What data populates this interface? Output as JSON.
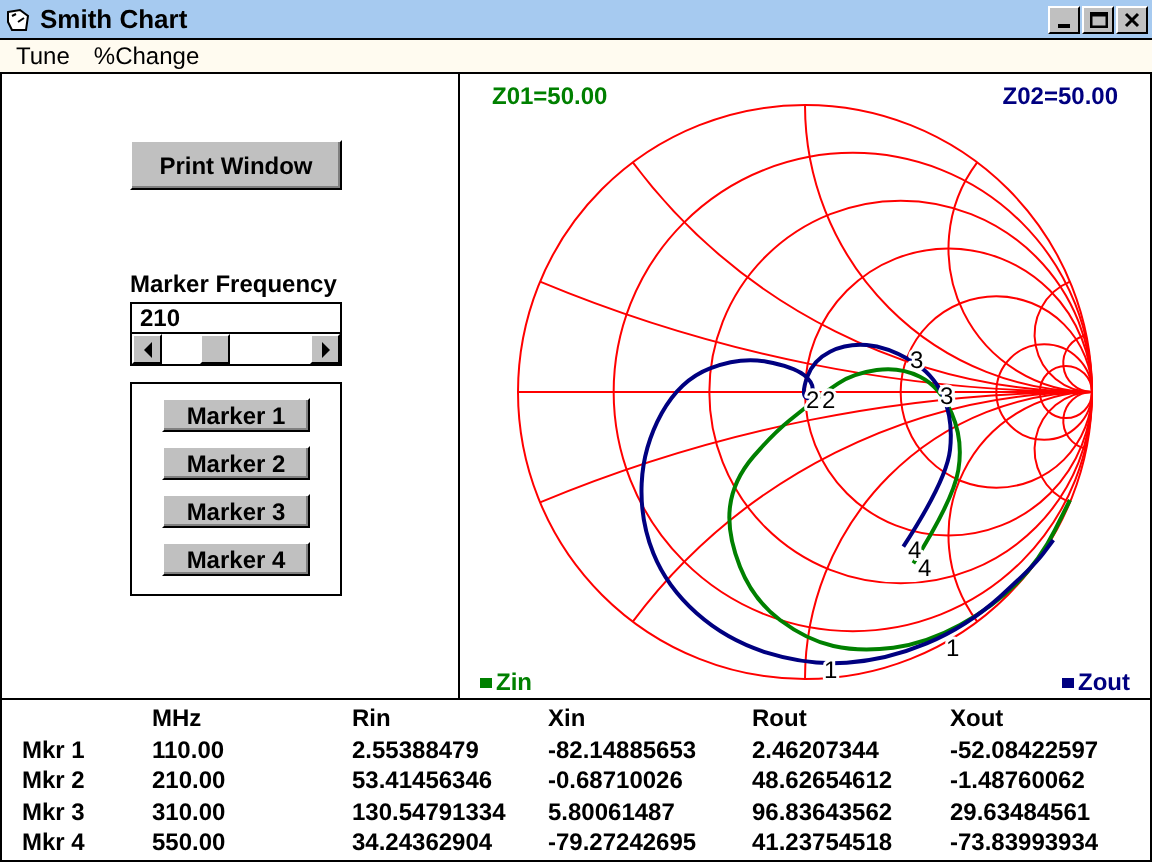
{
  "window": {
    "title": "Smith Chart"
  },
  "menu": [
    {
      "label": "Tune"
    },
    {
      "label": "%Change"
    }
  ],
  "controls": {
    "print_button": "Print Window",
    "frequency": {
      "label": "Marker Frequency",
      "value": "210",
      "level": 0.33
    },
    "marker_buttons": [
      "Marker 1",
      "Marker 2",
      "Marker 3",
      "Marker 4"
    ]
  },
  "chart": {
    "traces": [
      {
        "label": "Zin",
        "z0": "Z01=50.00",
        "color": "#008000",
        "markers": [
          "1",
          "2",
          "3",
          "4"
        ]
      },
      {
        "label": "Zout",
        "z0": "Z02=50.00",
        "color": "#000080",
        "markers": [
          "1",
          "2",
          "3",
          "4"
        ]
      }
    ]
  },
  "table": {
    "columns": [
      "MHz",
      "Rin",
      "Xin",
      "Rout",
      "Xout"
    ],
    "rows": [
      {
        "marker": "Mkr 1",
        "cells": [
          "110.00",
          "2.55388479",
          "-82.14885653",
          "2.46207344",
          "-52.08422597"
        ]
      },
      {
        "marker": "Mkr 2",
        "cells": [
          "210.00",
          "53.41456346",
          "-0.68710026",
          "48.62654612",
          "-1.48760062"
        ]
      },
      {
        "marker": "Mkr 3",
        "cells": [
          "310.00",
          "130.54791334",
          "5.80061487",
          "96.83643562",
          "29.63484561"
        ]
      },
      {
        "marker": "Mkr 4",
        "cells": [
          "550.00",
          "34.24362904",
          "-79.27242695",
          "41.23754518",
          "-73.83993934"
        ]
      }
    ]
  }
}
